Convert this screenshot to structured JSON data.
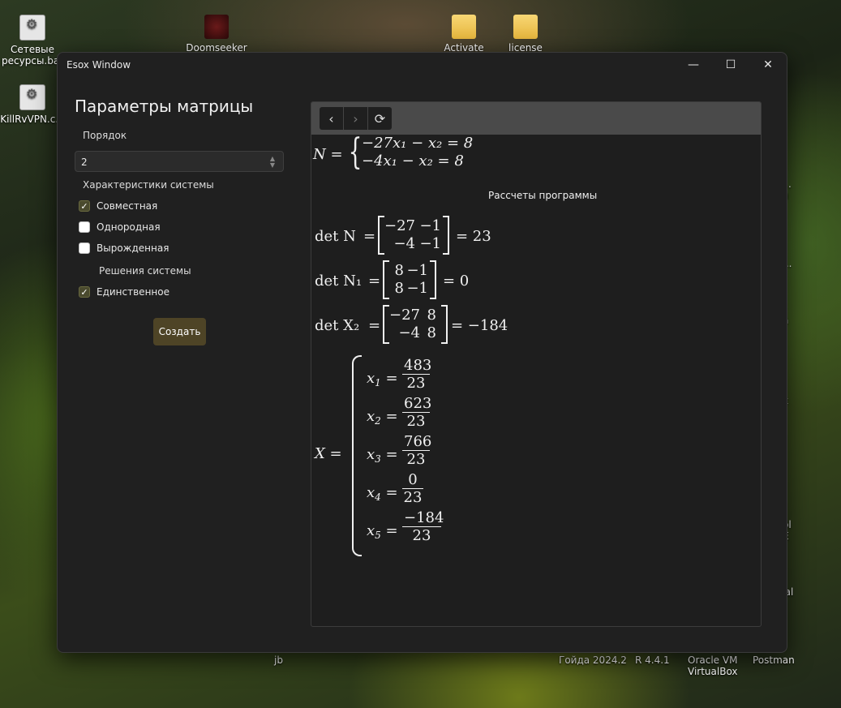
{
  "desktop": {
    "icons": [
      {
        "label": "Сетевые ресурсы.bat"
      },
      {
        "label": "KillRvVPN.c..."
      },
      {
        "label": "Doomseeker"
      },
      {
        "label": "Activate"
      },
      {
        "label": "license"
      }
    ],
    "bottom_labels": [
      "jb",
      "Гойда 2024.2",
      "R 4.4.1",
      "Oracle VM VirtualBox",
      "Postman"
    ],
    "right_fragments": [
      "е...",
      "ия",
      "...",
      "а",
      "x",
      "ol",
      "E",
      "ual"
    ]
  },
  "window": {
    "title": "Esox Window",
    "controls": {
      "minimize": "—",
      "maximize": "☐",
      "close": "✕"
    }
  },
  "form": {
    "heading": "Параметры матрицы",
    "order_label": "Порядок",
    "order_value": "2",
    "characteristics_label": "Характеристики системы",
    "checks": [
      {
        "label": "Совместная",
        "checked": true
      },
      {
        "label": "Однородная",
        "checked": false
      },
      {
        "label": "Вырожденная",
        "checked": false
      }
    ],
    "solutions_label": "Решения системы",
    "solution_checks": [
      {
        "label": "Единственное",
        "checked": true
      }
    ],
    "create_button": "Создать"
  },
  "browser": {
    "nav": {
      "back": "‹",
      "forward": "›",
      "refresh": "⟳"
    },
    "system": {
      "name": "N",
      "eq1": "−27x₁ − x₂ = 8",
      "eq2": "−4x₁ − x₂ = 8"
    },
    "calc_title": "Рассчеты программы",
    "determinants": [
      {
        "label": "det N",
        "matrix": [
          [
            "−27",
            "−1"
          ],
          [
            "−4",
            "−1"
          ]
        ],
        "result": "= 23"
      },
      {
        "label": "det N₁",
        "matrix": [
          [
            "8",
            "−1"
          ],
          [
            "8",
            "−1"
          ]
        ],
        "result": "= 0"
      },
      {
        "label": "det X₂",
        "matrix": [
          [
            "−27",
            "8"
          ],
          [
            "−4",
            "8"
          ]
        ],
        "result": "= −184"
      }
    ],
    "solution": {
      "name": "X =",
      "items": [
        {
          "var": "x",
          "idx": "1",
          "num": "483",
          "den": "23"
        },
        {
          "var": "x",
          "idx": "2",
          "num": "623",
          "den": "23"
        },
        {
          "var": "x",
          "idx": "3",
          "num": "766",
          "den": "23"
        },
        {
          "var": "x",
          "idx": "4",
          "num": "0",
          "den": "23"
        },
        {
          "var": "x",
          "idx": "5",
          "num": "−184",
          "den": "23"
        }
      ]
    }
  }
}
